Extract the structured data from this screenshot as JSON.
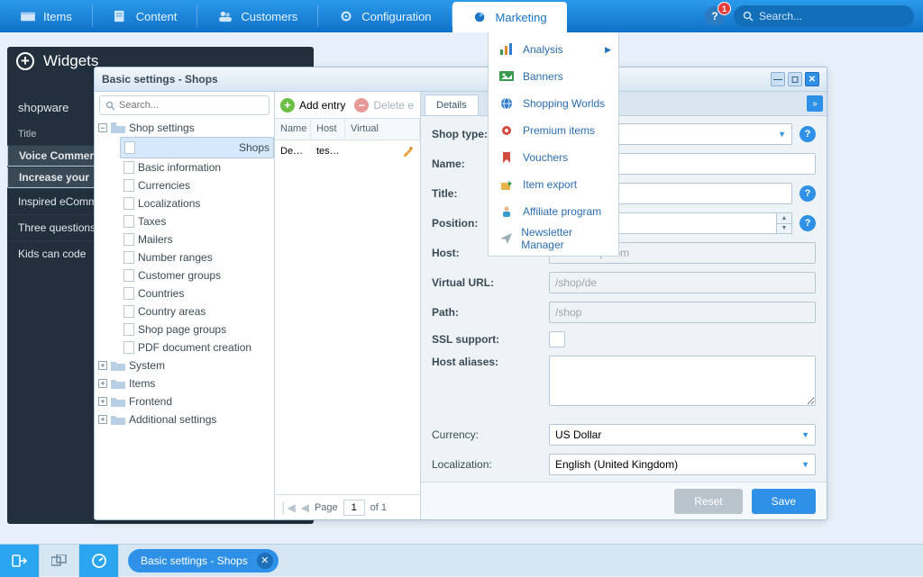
{
  "topnav": {
    "items": [
      "Items",
      "Content",
      "Customers",
      "Configuration",
      "Marketing"
    ],
    "search_placeholder": "Search...",
    "notification_count": "1"
  },
  "marketing_menu": [
    "Analysis",
    "Banners",
    "Shopping Worlds",
    "Premium items",
    "Vouchers",
    "Item export",
    "Affiliate program",
    "Newsletter Manager"
  ],
  "widgets": {
    "title": "Widgets",
    "brand": "shopware",
    "header": "Title",
    "rows": [
      "Voice Commerce",
      "Increase your",
      "Inspired eCommerce",
      "Three questions",
      "Kids can code"
    ]
  },
  "win": {
    "title": "Basic settings - Shops",
    "tree": {
      "search_placeholder": "Search...",
      "root": "Shop settings",
      "shops_children": [
        "Shops",
        "Basic information",
        "Currencies",
        "Localizations",
        "Taxes",
        "Mailers",
        "Number ranges",
        "Customer groups",
        "Countries",
        "Country areas",
        "Shop page groups",
        "PDF document creation"
      ],
      "siblings": [
        "System",
        "Items",
        "Frontend",
        "Additional settings"
      ]
    },
    "grid": {
      "add": "Add entry",
      "del": "Delete e",
      "cols": [
        "Name",
        "Host",
        "Virtual"
      ],
      "row": {
        "name": "De…",
        "host": "tes…"
      },
      "pager": {
        "label": "Page",
        "page": "1",
        "of": "of 1"
      }
    },
    "form": {
      "tab": "Details",
      "fields": {
        "shop_type": "Shop type:",
        "name": "Name:",
        "title": "Title:",
        "position": "Position:",
        "host": "Host:",
        "virtual_url": "Virtual URL:",
        "path": "Path:",
        "ssl": "SSL support:",
        "aliases": "Host aliases:",
        "currency": "Currency:",
        "localization": "Localization:"
      },
      "values": {
        "host": "demoshop.com",
        "virtual_url": "/shop/de",
        "path": "/shop",
        "currency": "US Dollar",
        "localization": "English (United Kingdom)"
      },
      "buttons": {
        "reset": "Reset",
        "save": "Save"
      }
    }
  },
  "taskbar": {
    "task": "Basic settings - Shops"
  }
}
